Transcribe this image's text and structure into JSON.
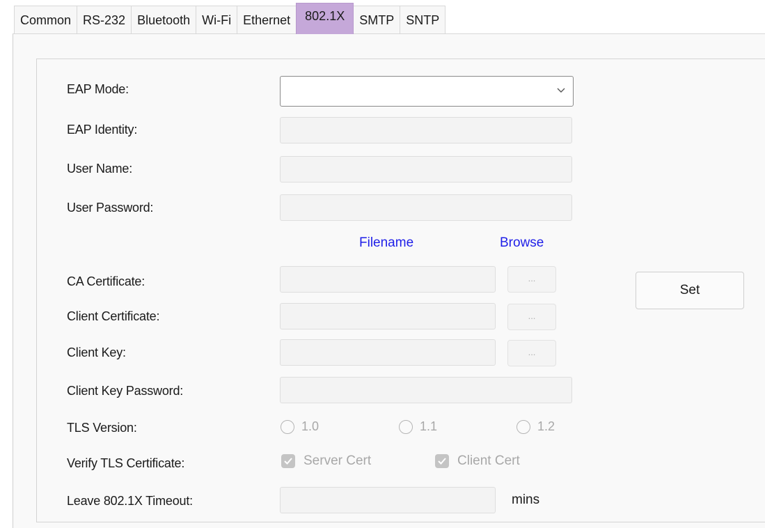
{
  "tabs": [
    {
      "label": "Common"
    },
    {
      "label": "RS-232"
    },
    {
      "label": "Bluetooth"
    },
    {
      "label": "Wi-Fi"
    },
    {
      "label": "Ethernet"
    },
    {
      "label": "802.1X"
    },
    {
      "label": "SMTP"
    },
    {
      "label": "SNTP"
    }
  ],
  "active_tab": "802.1X",
  "labels": {
    "eap_mode": "EAP Mode:",
    "eap_identity": "EAP Identity:",
    "user_name": "User Name:",
    "user_password": "User Password:",
    "ca_certificate": "CA Certificate:",
    "client_certificate": "Client Certificate:",
    "client_key": "Client Key:",
    "client_key_password": "Client Key Password:",
    "tls_version": "TLS Version:",
    "verify_tls_certificate": "Verify TLS Certificate:",
    "leave_timeout": "Leave 802.1X Timeout:"
  },
  "fields": {
    "eap_mode": {
      "value": ""
    },
    "eap_identity": {
      "value": ""
    },
    "user_name": {
      "value": ""
    },
    "user_password": {
      "value": ""
    },
    "ca_certificate": {
      "value": ""
    },
    "client_certificate": {
      "value": ""
    },
    "client_key": {
      "value": ""
    },
    "client_key_password": {
      "value": ""
    },
    "leave_timeout": {
      "value": ""
    }
  },
  "columns": {
    "filename": "Filename",
    "browse": "Browse"
  },
  "browse_button_label": "...",
  "set_button_label": "Set",
  "tls_versions": [
    {
      "label": "1.0",
      "selected": false
    },
    {
      "label": "1.1",
      "selected": false
    },
    {
      "label": "1.2",
      "selected": false
    }
  ],
  "verify_certs": [
    {
      "label": "Server Cert",
      "checked": true
    },
    {
      "label": "Client Cert",
      "checked": true
    }
  ],
  "timeout_unit": "mins",
  "colors": {
    "active_tab": "#c5a8d9",
    "column_header": "#1f1fe8",
    "disabled_text": "#a8a8a8"
  }
}
